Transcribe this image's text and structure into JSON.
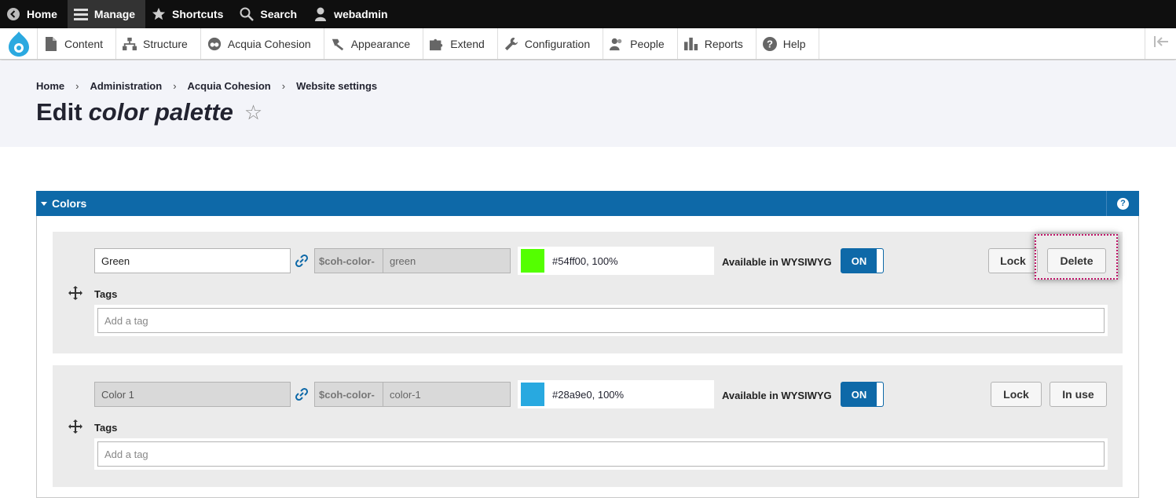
{
  "toolbar": {
    "home": "Home",
    "manage": "Manage",
    "shortcuts": "Shortcuts",
    "search": "Search",
    "user": "webadmin"
  },
  "tray": {
    "items": [
      "Content",
      "Structure",
      "Acquia Cohesion",
      "Appearance",
      "Extend",
      "Configuration",
      "People",
      "Reports",
      "Help"
    ]
  },
  "breadcrumb": [
    "Home",
    "Administration",
    "Acquia Cohesion",
    "Website settings"
  ],
  "breadcrumb_sep": "›",
  "page": {
    "title_plain": "Edit",
    "title_em": "color palette",
    "star": "☆"
  },
  "panel": {
    "title": "Colors",
    "help": "?"
  },
  "colors": [
    {
      "name": "Green",
      "var_prefix": "$coh-color-",
      "var_suffix": "green",
      "value": "#54ff00, 100%",
      "swatch": "#54ff00",
      "wysiwyg_label": "Available in WYSIWYG",
      "toggle": "ON",
      "lock": "Lock",
      "action": "Delete",
      "tags_label": "Tags",
      "tags_placeholder": "Add a tag"
    },
    {
      "name": "Color 1",
      "var_prefix": "$coh-color-",
      "var_suffix": "color-1",
      "value": "#28a9e0, 100%",
      "swatch": "#28a9e0",
      "wysiwyg_label": "Available in WYSIWYG",
      "toggle": "ON",
      "lock": "Lock",
      "action": "In use",
      "tags_label": "Tags",
      "tags_placeholder": "Add a tag"
    }
  ]
}
